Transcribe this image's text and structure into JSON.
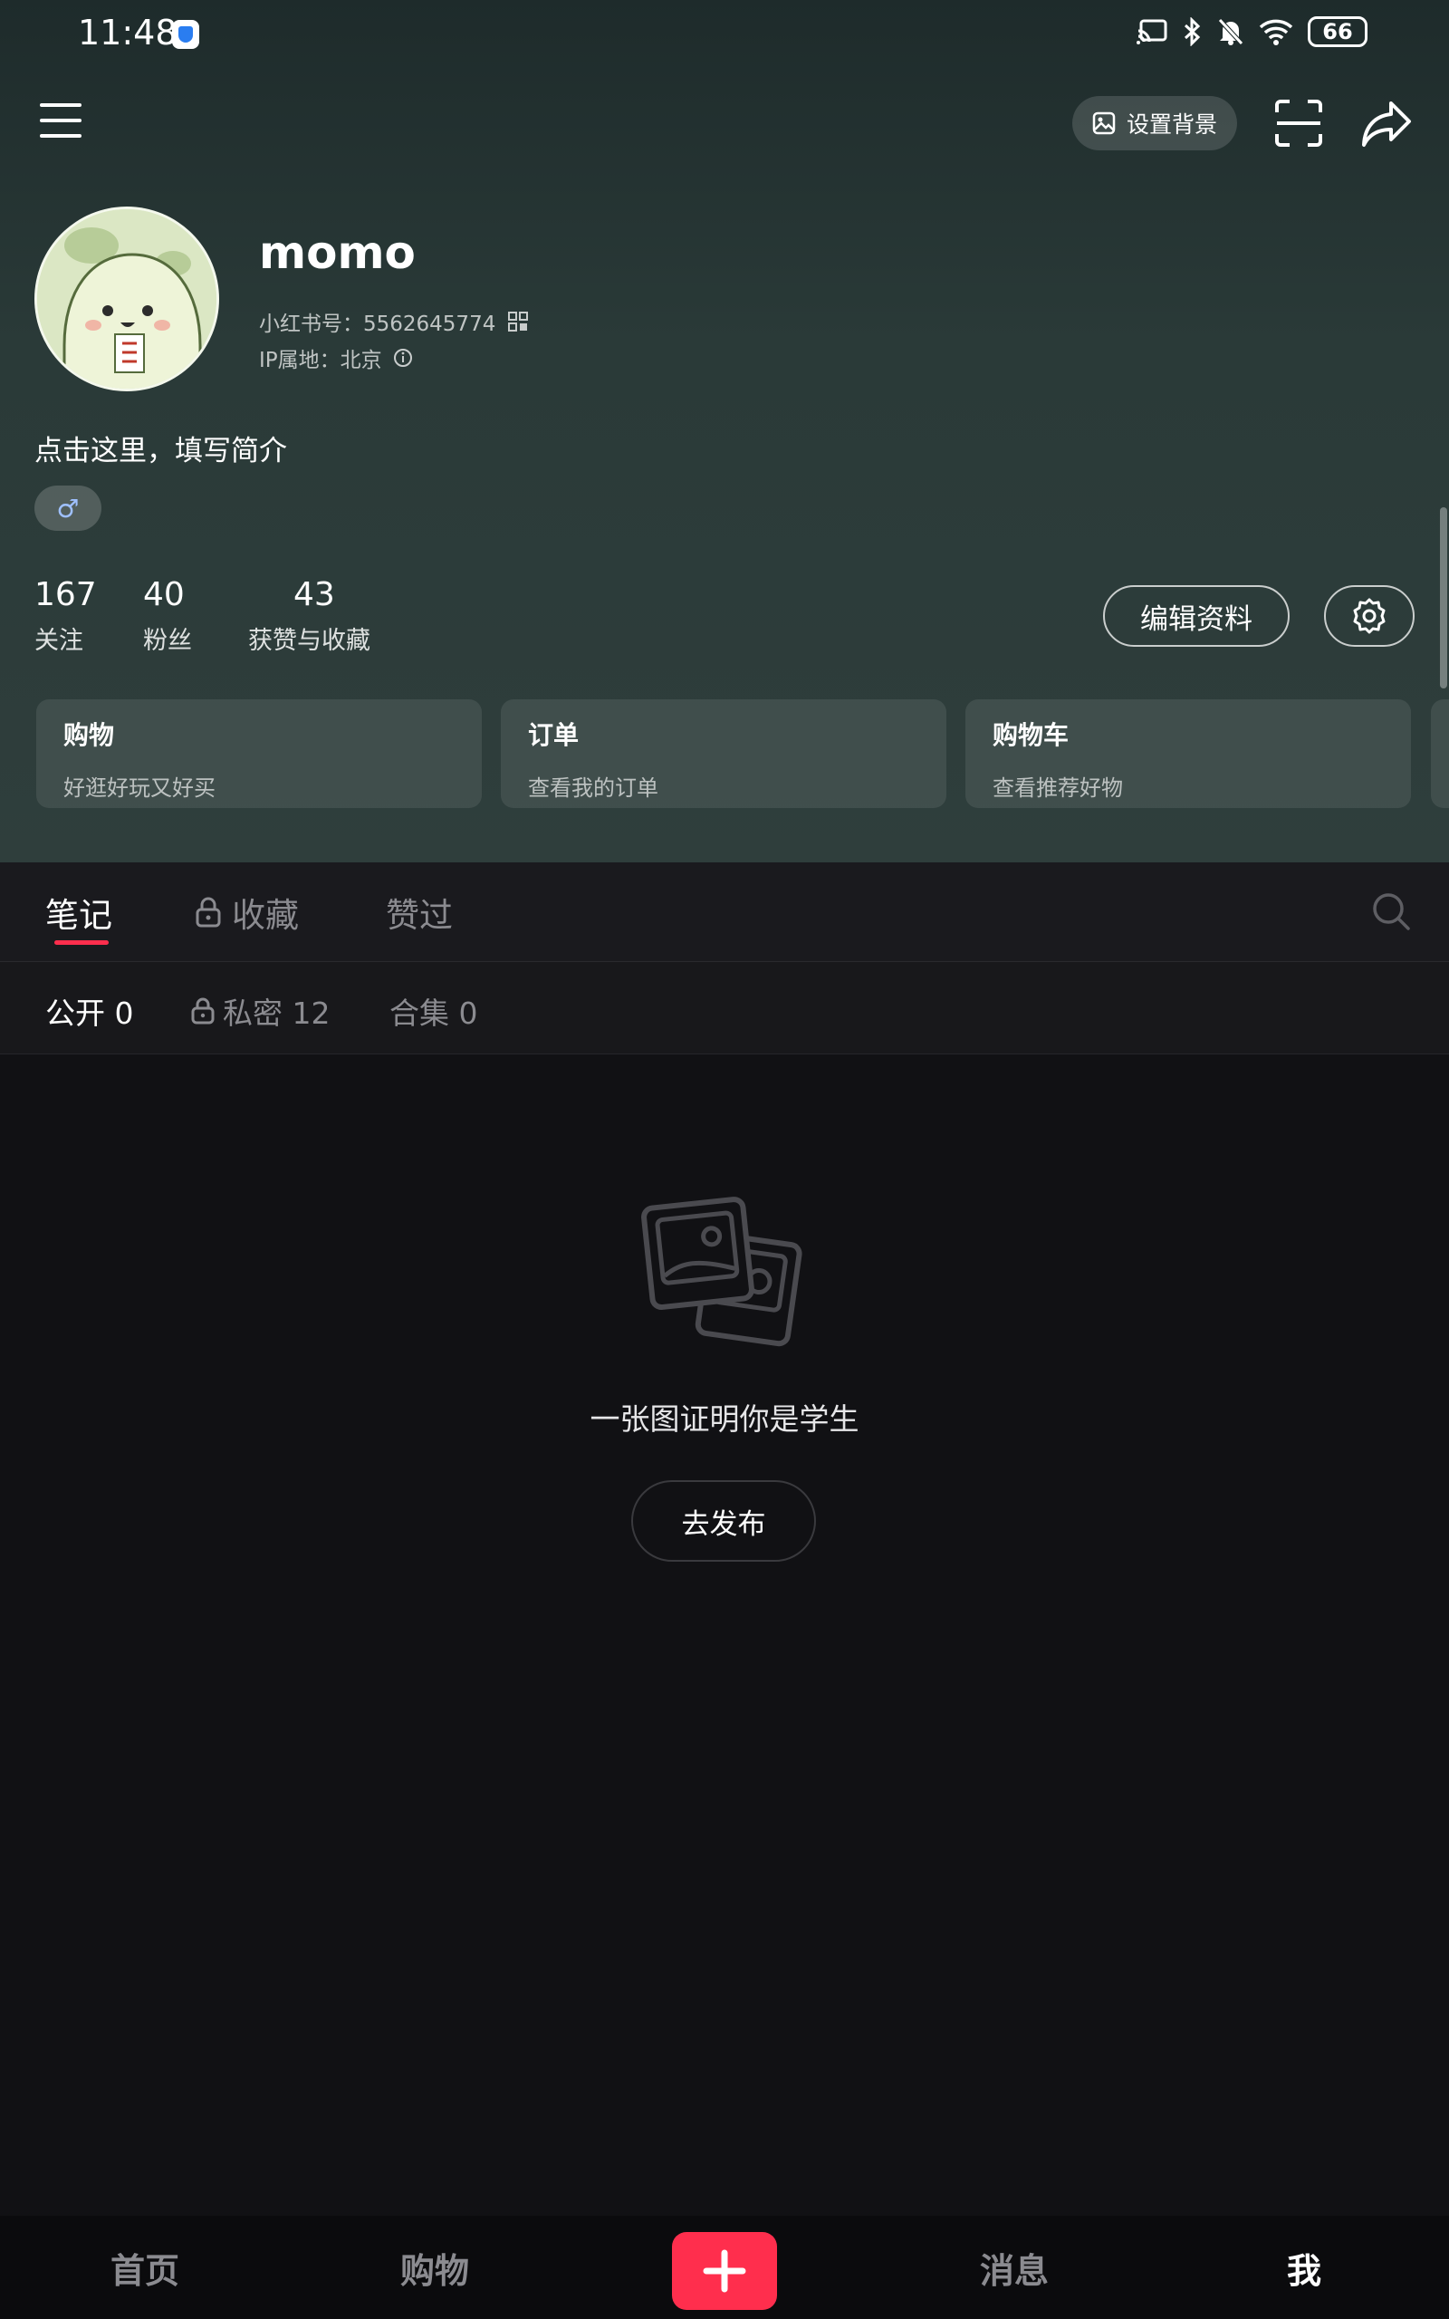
{
  "status_bar": {
    "time": "11:48",
    "battery": "66",
    "icons": [
      "cast-icon",
      "bluetooth-icon",
      "mute-bell-icon",
      "wifi-icon",
      "battery-icon"
    ]
  },
  "topbar": {
    "set_background_label": "设置背景"
  },
  "profile": {
    "username": "momo",
    "rednote_id_label": "小红书号：5562645774",
    "ip_location_label": "IP属地：北京",
    "bio_placeholder": "点击这里，填写简介",
    "gender_symbol": "♂"
  },
  "stats": [
    {
      "count": "167",
      "label": "关注"
    },
    {
      "count": "40",
      "label": "粉丝"
    },
    {
      "count": "43",
      "label": "获赞与收藏"
    }
  ],
  "actions": {
    "edit_profile": "编辑资料"
  },
  "cards": [
    {
      "title": "购物",
      "subtitle": "好逛好玩又好买"
    },
    {
      "title": "订单",
      "subtitle": "查看我的订单"
    },
    {
      "title": "购物车",
      "subtitle": "查看推荐好物"
    }
  ],
  "tabs": [
    {
      "label": "笔记",
      "active": true
    },
    {
      "label": "收藏",
      "locked": true
    },
    {
      "label": "赞过"
    }
  ],
  "subtabs": [
    {
      "label": "公开 0",
      "active": true
    },
    {
      "label": "私密 12",
      "locked": true
    },
    {
      "label": "合集 0"
    }
  ],
  "empty_state": {
    "message": "一张图证明你是学生",
    "button": "去发布"
  },
  "bottom_nav": [
    {
      "label": "首页"
    },
    {
      "label": "购物"
    },
    {
      "label": "消息"
    },
    {
      "label": "我",
      "active": true
    }
  ],
  "colors": {
    "accent": "#ff2e4d",
    "header_bg": "#2a3a38",
    "page_bg": "#111114"
  }
}
